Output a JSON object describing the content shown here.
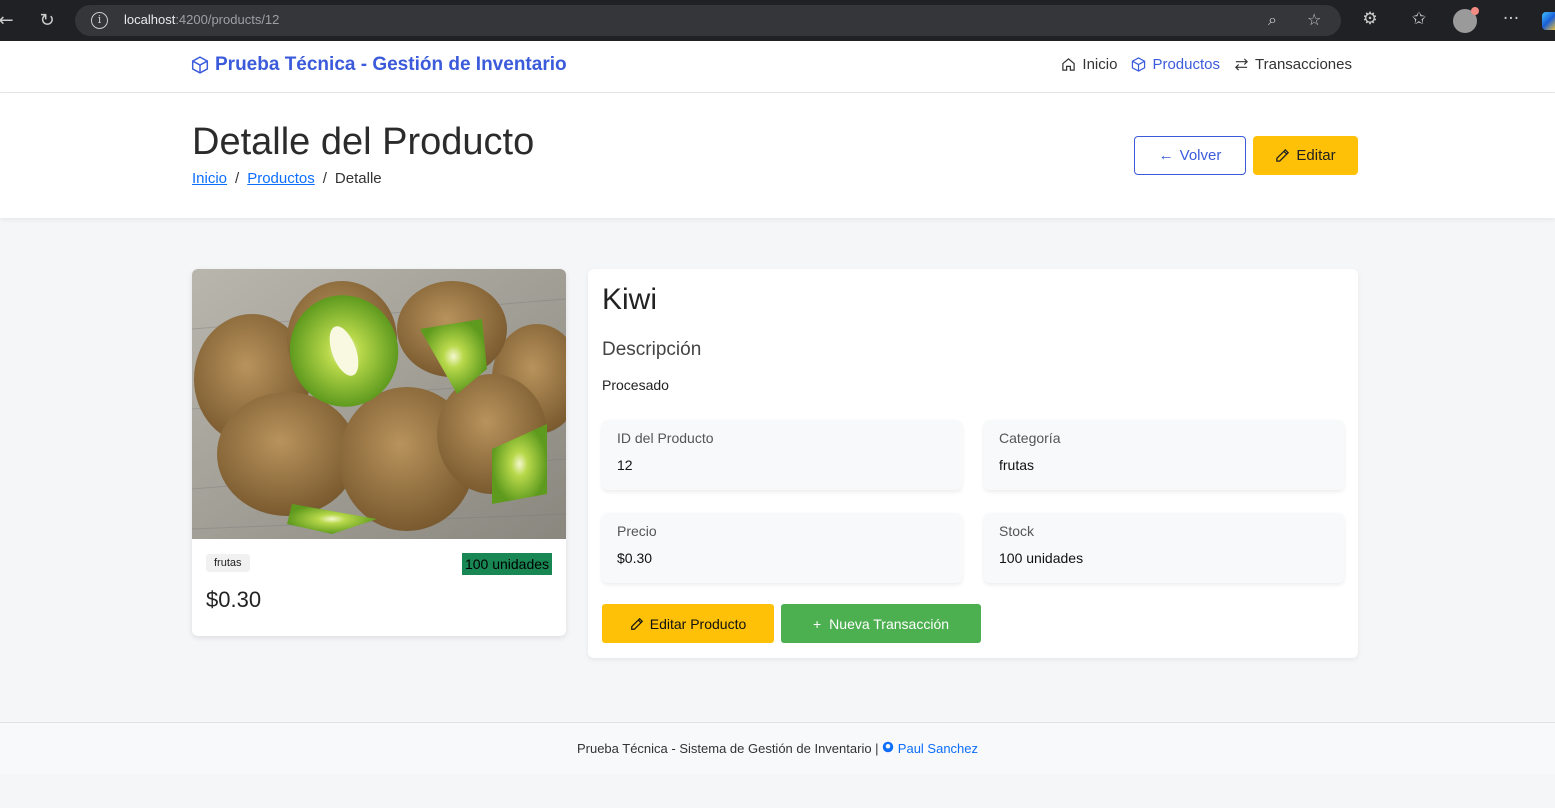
{
  "browser": {
    "url_host": "localhost",
    "url_path": ":4200/products/12"
  },
  "navbar": {
    "brand": "Prueba Técnica - Gestión de Inventario",
    "links": [
      {
        "label": "Inicio",
        "icon": "home-icon"
      },
      {
        "label": "Productos",
        "icon": "box-icon",
        "active": true
      },
      {
        "label": "Transacciones",
        "icon": "swap-icon"
      }
    ]
  },
  "header": {
    "title": "Detalle del Producto",
    "breadcrumb": [
      "Inicio",
      "Productos",
      "Detalle"
    ],
    "back_label": "Volver",
    "edit_label": "Editar"
  },
  "product": {
    "category_badge": "frutas",
    "stock_badge": "100 unidades",
    "price": "$0.30",
    "name": "Kiwi",
    "description_heading": "Descripción",
    "description": "Procesado",
    "fields": {
      "id_label": "ID del Producto",
      "id_value": "12",
      "category_label": "Categoría",
      "category_value": "frutas",
      "price_label": "Precio",
      "price_value": "$0.30",
      "stock_label": "Stock",
      "stock_value": "100 unidades"
    },
    "edit_product_label": "Editar Producto",
    "new_transaction_label": "Nueva Transacción"
  },
  "footer": {
    "text": "Prueba Técnica - Sistema de Gestión de Inventario |",
    "author": "Paul Sanchez"
  },
  "colors": {
    "primary": "#3b5bdb",
    "warning": "#ffc107",
    "success": "#4caf50",
    "stock_badge": "#198754"
  }
}
